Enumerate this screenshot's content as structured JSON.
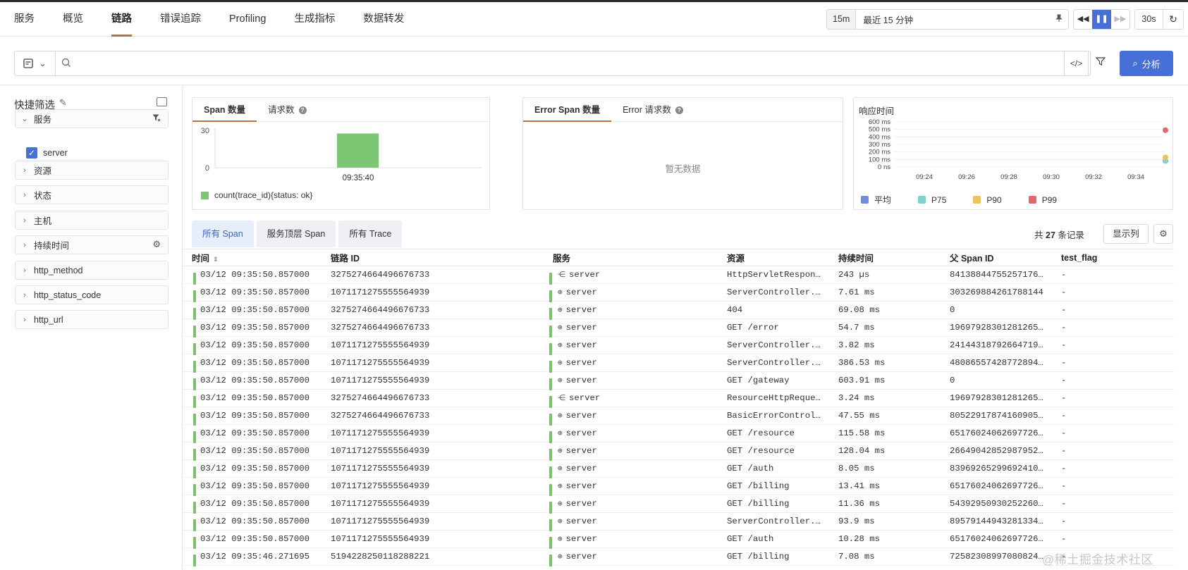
{
  "nav": {
    "tabs": [
      "服务",
      "概览",
      "链路",
      "错误追踪",
      "Profiling",
      "生成指标",
      "数据转发"
    ],
    "active_tab": "链路"
  },
  "time": {
    "preset": "15m",
    "range_label": "最近 15 分钟",
    "refresh_interval": "30s"
  },
  "search": {
    "placeholder": "",
    "analyze_label": "分析"
  },
  "sidebar": {
    "title": "快捷筛选",
    "facets": [
      {
        "label": "服务",
        "expanded": true,
        "options": [
          {
            "label": "server",
            "checked": true
          }
        ]
      },
      {
        "label": "资源"
      },
      {
        "label": "状态"
      },
      {
        "label": "主机"
      },
      {
        "label": "持续时间"
      },
      {
        "label": "http_method"
      },
      {
        "label": "http_status_code"
      },
      {
        "label": "http_url"
      }
    ]
  },
  "cards": {
    "span_count": {
      "tabs": [
        "Span 数量",
        "请求数"
      ],
      "y_ticks": [
        "30",
        "0"
      ],
      "x_tick": "09:35:40",
      "legend": "count(trace_id){status: ok}",
      "bar_color": "#7dc774"
    },
    "error_span": {
      "tabs": [
        "Error Span 数量",
        "Error 请求数"
      ],
      "empty_text": "暂无数据"
    },
    "response_time": {
      "title": "响应时间",
      "y_ticks": [
        "600 ms",
        "500 ms",
        "400 ms",
        "300 ms",
        "200 ms",
        "100 ms",
        "0 ns"
      ],
      "x_ticks": [
        "09:24",
        "09:26",
        "09:28",
        "09:30",
        "09:32",
        "09:34"
      ],
      "legend": [
        {
          "label": "平均",
          "color": "#6f8fdc"
        },
        {
          "label": "P75",
          "color": "#7fd3cf"
        },
        {
          "label": "P90",
          "color": "#eac45b"
        },
        {
          "label": "P99",
          "color": "#e06a6a"
        }
      ]
    }
  },
  "chart_data": [
    {
      "type": "bar",
      "categories": [
        "09:35:40"
      ],
      "series": [
        {
          "name": "count(trace_id){status: ok}",
          "values": [
            27
          ]
        }
      ],
      "ylim": [
        0,
        30
      ]
    },
    {
      "type": "scatter",
      "title": "响应时间",
      "x": [
        "09:35"
      ],
      "series": [
        {
          "name": "平均",
          "values": [
            82
          ]
        },
        {
          "name": "P75",
          "values": [
            82
          ]
        },
        {
          "name": "P90",
          "values": [
            128
          ]
        },
        {
          "name": "P99",
          "values": [
            490
          ]
        }
      ],
      "ylim": [
        0,
        600
      ]
    }
  ],
  "list": {
    "tabs": [
      "所有 Span",
      "服务顶层 Span",
      "所有 Trace"
    ],
    "total_prefix": "共",
    "total_count": "27",
    "total_suffix": "条记录",
    "columns_button": "显示列",
    "columns": [
      "时间",
      "链路 ID",
      "服务",
      "资源",
      "持续时间",
      "父 Span ID",
      "test_flag"
    ],
    "rows": [
      {
        "time": "03/12 09:35:50.857000",
        "trace_id": "3275274664496676733",
        "svc_icon": "share-icon",
        "service": "server",
        "resource": "HttpServletRespon…",
        "duration": "243 µs",
        "parent": "84138844755257176…",
        "flag": "-"
      },
      {
        "time": "03/12 09:35:50.857000",
        "trace_id": "1071171275555564939",
        "svc_icon": "globe-icon",
        "service": "server",
        "resource": "ServerController.…",
        "duration": "7.61 ms",
        "parent": "303269884261788144",
        "flag": "-"
      },
      {
        "time": "03/12 09:35:50.857000",
        "trace_id": "3275274664496676733",
        "svc_icon": "globe-icon",
        "service": "server",
        "resource": "404",
        "duration": "69.08 ms",
        "parent": "0",
        "flag": "-"
      },
      {
        "time": "03/12 09:35:50.857000",
        "trace_id": "3275274664496676733",
        "svc_icon": "globe-icon",
        "service": "server",
        "resource": "GET /error",
        "duration": "54.7 ms",
        "parent": "19697928301281265…",
        "flag": "-"
      },
      {
        "time": "03/12 09:35:50.857000",
        "trace_id": "1071171275555564939",
        "svc_icon": "globe-icon",
        "service": "server",
        "resource": "ServerController.…",
        "duration": "3.82 ms",
        "parent": "24144318792664719…",
        "flag": "-"
      },
      {
        "time": "03/12 09:35:50.857000",
        "trace_id": "1071171275555564939",
        "svc_icon": "globe-icon",
        "service": "server",
        "resource": "ServerController.…",
        "duration": "386.53 ms",
        "parent": "48086557428772894…",
        "flag": "-"
      },
      {
        "time": "03/12 09:35:50.857000",
        "trace_id": "1071171275555564939",
        "svc_icon": "globe-icon",
        "service": "server",
        "resource": "GET /gateway",
        "duration": "603.91 ms",
        "parent": "0",
        "flag": "-"
      },
      {
        "time": "03/12 09:35:50.857000",
        "trace_id": "3275274664496676733",
        "svc_icon": "share-icon",
        "service": "server",
        "resource": "ResourceHttpReque…",
        "duration": "3.24 ms",
        "parent": "19697928301281265…",
        "flag": "-"
      },
      {
        "time": "03/12 09:35:50.857000",
        "trace_id": "3275274664496676733",
        "svc_icon": "globe-icon",
        "service": "server",
        "resource": "BasicErrorControl…",
        "duration": "47.55 ms",
        "parent": "80522917874160905…",
        "flag": "-"
      },
      {
        "time": "03/12 09:35:50.857000",
        "trace_id": "1071171275555564939",
        "svc_icon": "globe-icon",
        "service": "server",
        "resource": "GET /resource",
        "duration": "115.58 ms",
        "parent": "65176024062697726…",
        "flag": "-"
      },
      {
        "time": "03/12 09:35:50.857000",
        "trace_id": "1071171275555564939",
        "svc_icon": "globe-icon",
        "service": "server",
        "resource": "GET /resource",
        "duration": "128.04 ms",
        "parent": "26649042852987952…",
        "flag": "-"
      },
      {
        "time": "03/12 09:35:50.857000",
        "trace_id": "1071171275555564939",
        "svc_icon": "globe-icon",
        "service": "server",
        "resource": "GET /auth",
        "duration": "8.05 ms",
        "parent": "83969265299692410…",
        "flag": "-"
      },
      {
        "time": "03/12 09:35:50.857000",
        "trace_id": "1071171275555564939",
        "svc_icon": "globe-icon",
        "service": "server",
        "resource": "GET /billing",
        "duration": "13.41 ms",
        "parent": "65176024062697726…",
        "flag": "-"
      },
      {
        "time": "03/12 09:35:50.857000",
        "trace_id": "1071171275555564939",
        "svc_icon": "globe-icon",
        "service": "server",
        "resource": "GET /billing",
        "duration": "11.36 ms",
        "parent": "54392950930252260…",
        "flag": "-"
      },
      {
        "time": "03/12 09:35:50.857000",
        "trace_id": "1071171275555564939",
        "svc_icon": "globe-icon",
        "service": "server",
        "resource": "ServerController.…",
        "duration": "93.9 ms",
        "parent": "89579144943281334…",
        "flag": "-"
      },
      {
        "time": "03/12 09:35:50.857000",
        "trace_id": "1071171275555564939",
        "svc_icon": "globe-icon",
        "service": "server",
        "resource": "GET /auth",
        "duration": "10.28 ms",
        "parent": "65176024062697726…",
        "flag": "-"
      },
      {
        "time": "03/12 09:35:46.271695",
        "trace_id": "5194228250118288221",
        "svc_icon": "globe-icon",
        "service": "server",
        "resource": "GET /billing",
        "duration": "7.08 ms",
        "parent": "72582308997080824…",
        "flag": "-"
      }
    ]
  },
  "watermark": "@稀土掘金技术社区"
}
